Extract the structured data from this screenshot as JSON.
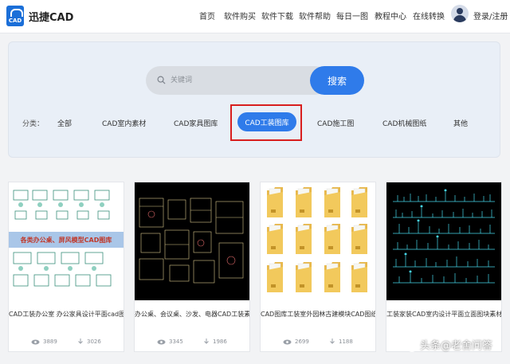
{
  "header": {
    "logo_text": "迅捷CAD",
    "logo_badge": "CAD",
    "nav": [
      "首页",
      "软件购买",
      "软件下载",
      "软件帮助",
      "每日一图",
      "教程中心",
      "在线转换"
    ],
    "login": "登录/注册"
  },
  "search": {
    "placeholder": "关键词",
    "button": "搜索"
  },
  "categories": {
    "label": "分类：",
    "items": [
      "全部",
      "CAD室内素材",
      "CAD家具图库",
      "CAD工装图库",
      "CAD施工图",
      "CAD机械图纸",
      "其他"
    ],
    "active": "CAD工装图库"
  },
  "cards": [
    {
      "banner": "各类办公桌、屏风模型CAD图库",
      "title": "CAD工装办公室 办公家具设计平面cad图块...",
      "views": "3889",
      "downloads": "3026"
    },
    {
      "title": "办公桌、会议桌、沙发、电器CAD工装素材...",
      "views": "3345",
      "downloads": "1986"
    },
    {
      "title": "CAD图库工装室外园林古建模块CAD图纸下...",
      "views": "2699",
      "downloads": "1188"
    },
    {
      "title": "工装家装CAD室内设计平面立面图块素材",
      "views": "",
      "downloads": ""
    }
  ],
  "watermark": "头条@老舍问答",
  "colors": {
    "accent": "#2f7bea",
    "highlight": "#d81e1e",
    "dark_card": "#000000"
  }
}
